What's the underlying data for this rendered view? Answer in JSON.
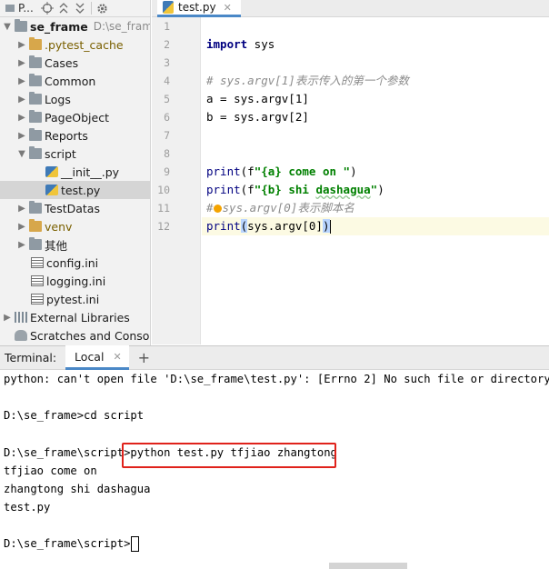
{
  "project_panel": {
    "toolbar_title": "P...",
    "tree": [
      {
        "label": "se_frame",
        "hint": "D:\\se_frame",
        "expanded": true,
        "icon": "folder-icon"
      },
      {
        "label": ".pytest_cache",
        "icon": "folder-icon"
      },
      {
        "label": "Cases",
        "icon": "folder-icon"
      },
      {
        "label": "Common",
        "icon": "folder-icon"
      },
      {
        "label": "Logs",
        "icon": "folder-icon"
      },
      {
        "label": "PageObject",
        "icon": "folder-icon"
      },
      {
        "label": "Reports",
        "icon": "folder-icon"
      },
      {
        "label": "script",
        "expanded": true,
        "icon": "folder-icon"
      },
      {
        "label": "__init__.py",
        "icon": "python-file-icon"
      },
      {
        "label": "test.py",
        "icon": "python-file-icon",
        "selected": true
      },
      {
        "label": "TestDatas",
        "icon": "folder-icon"
      },
      {
        "label": "venv",
        "icon": "folder-icon"
      },
      {
        "label": "其他",
        "icon": "folder-icon"
      },
      {
        "label": "config.ini",
        "icon": "ini-file-icon"
      },
      {
        "label": "logging.ini",
        "icon": "ini-file-icon"
      },
      {
        "label": "pytest.ini",
        "icon": "ini-file-icon"
      },
      {
        "label": "External Libraries",
        "icon": "library-icon"
      },
      {
        "label": "Scratches and Consoles",
        "icon": "scratch-icon"
      }
    ]
  },
  "editor": {
    "tab": "test.py",
    "line_numbers": [
      "1",
      "2",
      "3",
      "4",
      "5",
      "6",
      "7",
      "8",
      "9",
      "10",
      "11",
      "12"
    ],
    "code": {
      "l2_kw": "import",
      "l2_rest": " sys",
      "l4": "# sys.argv[1]表示传入的第一个参数",
      "l5": "a = sys.argv[1]",
      "l6": "b = sys.argv[2]",
      "l9_fn": "print",
      "l9_open": "(f",
      "l9_str": "\"{a} come on \"",
      "l9_close": ")",
      "l10_fn": "print",
      "l10_open": "(f",
      "l10_str_a": "\"{b} shi ",
      "l10_str_b": "dashagua",
      "l10_str_c": "\"",
      "l10_close": ")",
      "l11_hash": "#",
      "l11_rest": "sys.argv[0]表示脚本名",
      "l12_fn": "print",
      "l12_lp": "(",
      "l12_mid": "sys.argv[0]",
      "l12_rp": ")"
    }
  },
  "terminal": {
    "label": "Terminal:",
    "tab": "Local",
    "lines": [
      "python: can't open file 'D:\\se_frame\\test.py': [Errno 2] No such file or directory",
      "",
      "D:\\se_frame>cd script",
      "",
      "D:\\se_frame\\script>python test.py tfjiao zhangtong",
      "tfjiao come on",
      "zhangtong shi dashagua",
      "test.py",
      "",
      "D:\\se_frame\\script>"
    ]
  },
  "colors": {
    "accent": "#4a88c7",
    "highlight_box": "#e0221b",
    "keyword": "#000080",
    "string": "#008000",
    "comment": "#8c8c8c"
  }
}
